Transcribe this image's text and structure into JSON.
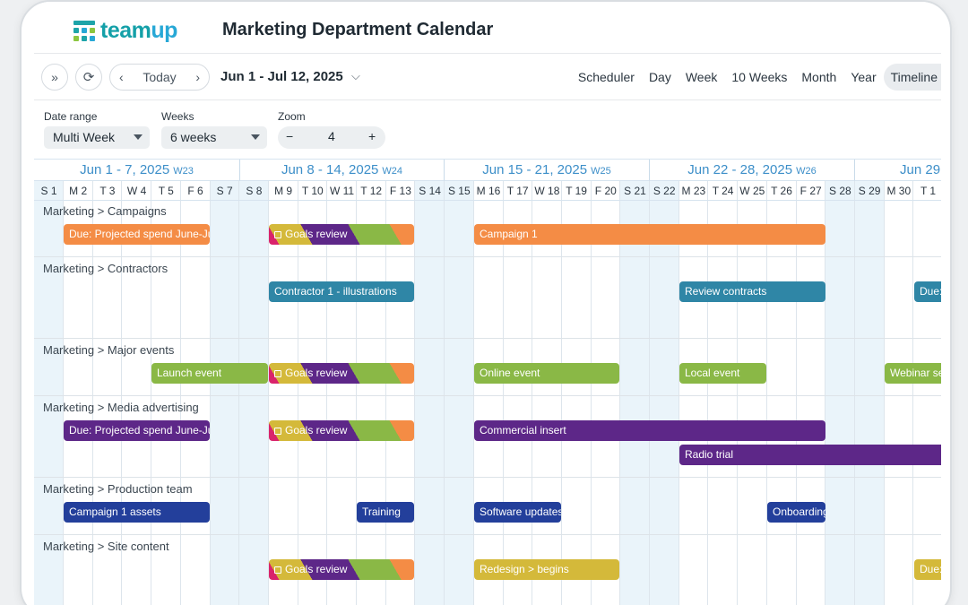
{
  "header": {
    "logo_text_a": "team",
    "logo_text_b": "up",
    "title": "Marketing Department Calendar"
  },
  "toolbar": {
    "today_label": "Today",
    "date_range": "Jun 1 - Jul 12, 2025",
    "views": [
      "Scheduler",
      "Day",
      "Week",
      "10 Weeks",
      "Month",
      "Year",
      "Timeline"
    ],
    "active_view": "Timeline"
  },
  "filters": {
    "date_range_label": "Date range",
    "date_range_value": "Multi Week",
    "weeks_label": "Weeks",
    "weeks_value": "6 weeks",
    "zoom_label": "Zoom",
    "zoom_value": "4",
    "zoom_minus": "−",
    "zoom_plus": "+"
  },
  "timeline": {
    "weeks": [
      {
        "label": "Jun 1 - 7, 2025",
        "num": "W23"
      },
      {
        "label": "Jun 8 - 14, 2025",
        "num": "W24"
      },
      {
        "label": "Jun 15 - 21, 2025",
        "num": "W25"
      },
      {
        "label": "Jun 22 - 28, 2025",
        "num": "W26"
      },
      {
        "label": "Jun 29",
        "num": ""
      }
    ],
    "days": [
      "S 1",
      "M 2",
      "T 3",
      "W 4",
      "T 5",
      "F 6",
      "S 7",
      "S 8",
      "M 9",
      "T 10",
      "W 11",
      "T 12",
      "F 13",
      "S 14",
      "S 15",
      "M 16",
      "T 17",
      "W 18",
      "T 19",
      "F 20",
      "S 21",
      "S 22",
      "M 23",
      "T 24",
      "W 25",
      "T 26",
      "F 27",
      "S 28",
      "S 29",
      "M 30",
      "T 1"
    ],
    "rows": [
      {
        "label": "Marketing > Campaigns"
      },
      {
        "label": "Marketing > Contractors"
      },
      {
        "label": "Marketing > Major events"
      },
      {
        "label": "Marketing > Media advertising"
      },
      {
        "label": "Marketing > Production team"
      },
      {
        "label": "Marketing > Site content"
      }
    ],
    "events": [
      {
        "title": "Due: Projected spend June-July",
        "color": "#f48c45"
      },
      {
        "title": "Goals review",
        "color": "goals"
      },
      {
        "title": "Campaign 1",
        "color": "#f48c45"
      },
      {
        "title": "Contractor 1 - illustrations",
        "color": "#2f86a6"
      },
      {
        "title": "Review contracts",
        "color": "#2f86a6"
      },
      {
        "title": "Due: contracts",
        "color": "#2f86a6"
      },
      {
        "title": "Launch event",
        "color": "#8ab846"
      },
      {
        "title": "Goals review",
        "color": "goals"
      },
      {
        "title": "Online event",
        "color": "#8ab846"
      },
      {
        "title": "Local event",
        "color": "#8ab846"
      },
      {
        "title": "Webinar series",
        "color": "#8ab846"
      },
      {
        "title": "Due: Projected spend June-July",
        "color": "#5d2788"
      },
      {
        "title": "Goals review",
        "color": "goals"
      },
      {
        "title": "Commercial insert",
        "color": "#5d2788"
      },
      {
        "title": "Radio trial",
        "color": "#5d2788"
      },
      {
        "title": "Campaign 1 assets",
        "color": "#233f9b"
      },
      {
        "title": "Training",
        "color": "#233f9b"
      },
      {
        "title": "Software updates",
        "color": "#233f9b"
      },
      {
        "title": "Onboarding",
        "color": "#233f9b"
      },
      {
        "title": "Goals review",
        "color": "goals"
      },
      {
        "title": "Redesign > begins",
        "color": "#d4b93a"
      },
      {
        "title": "Due: updates",
        "color": "#d4b93a"
      }
    ]
  }
}
